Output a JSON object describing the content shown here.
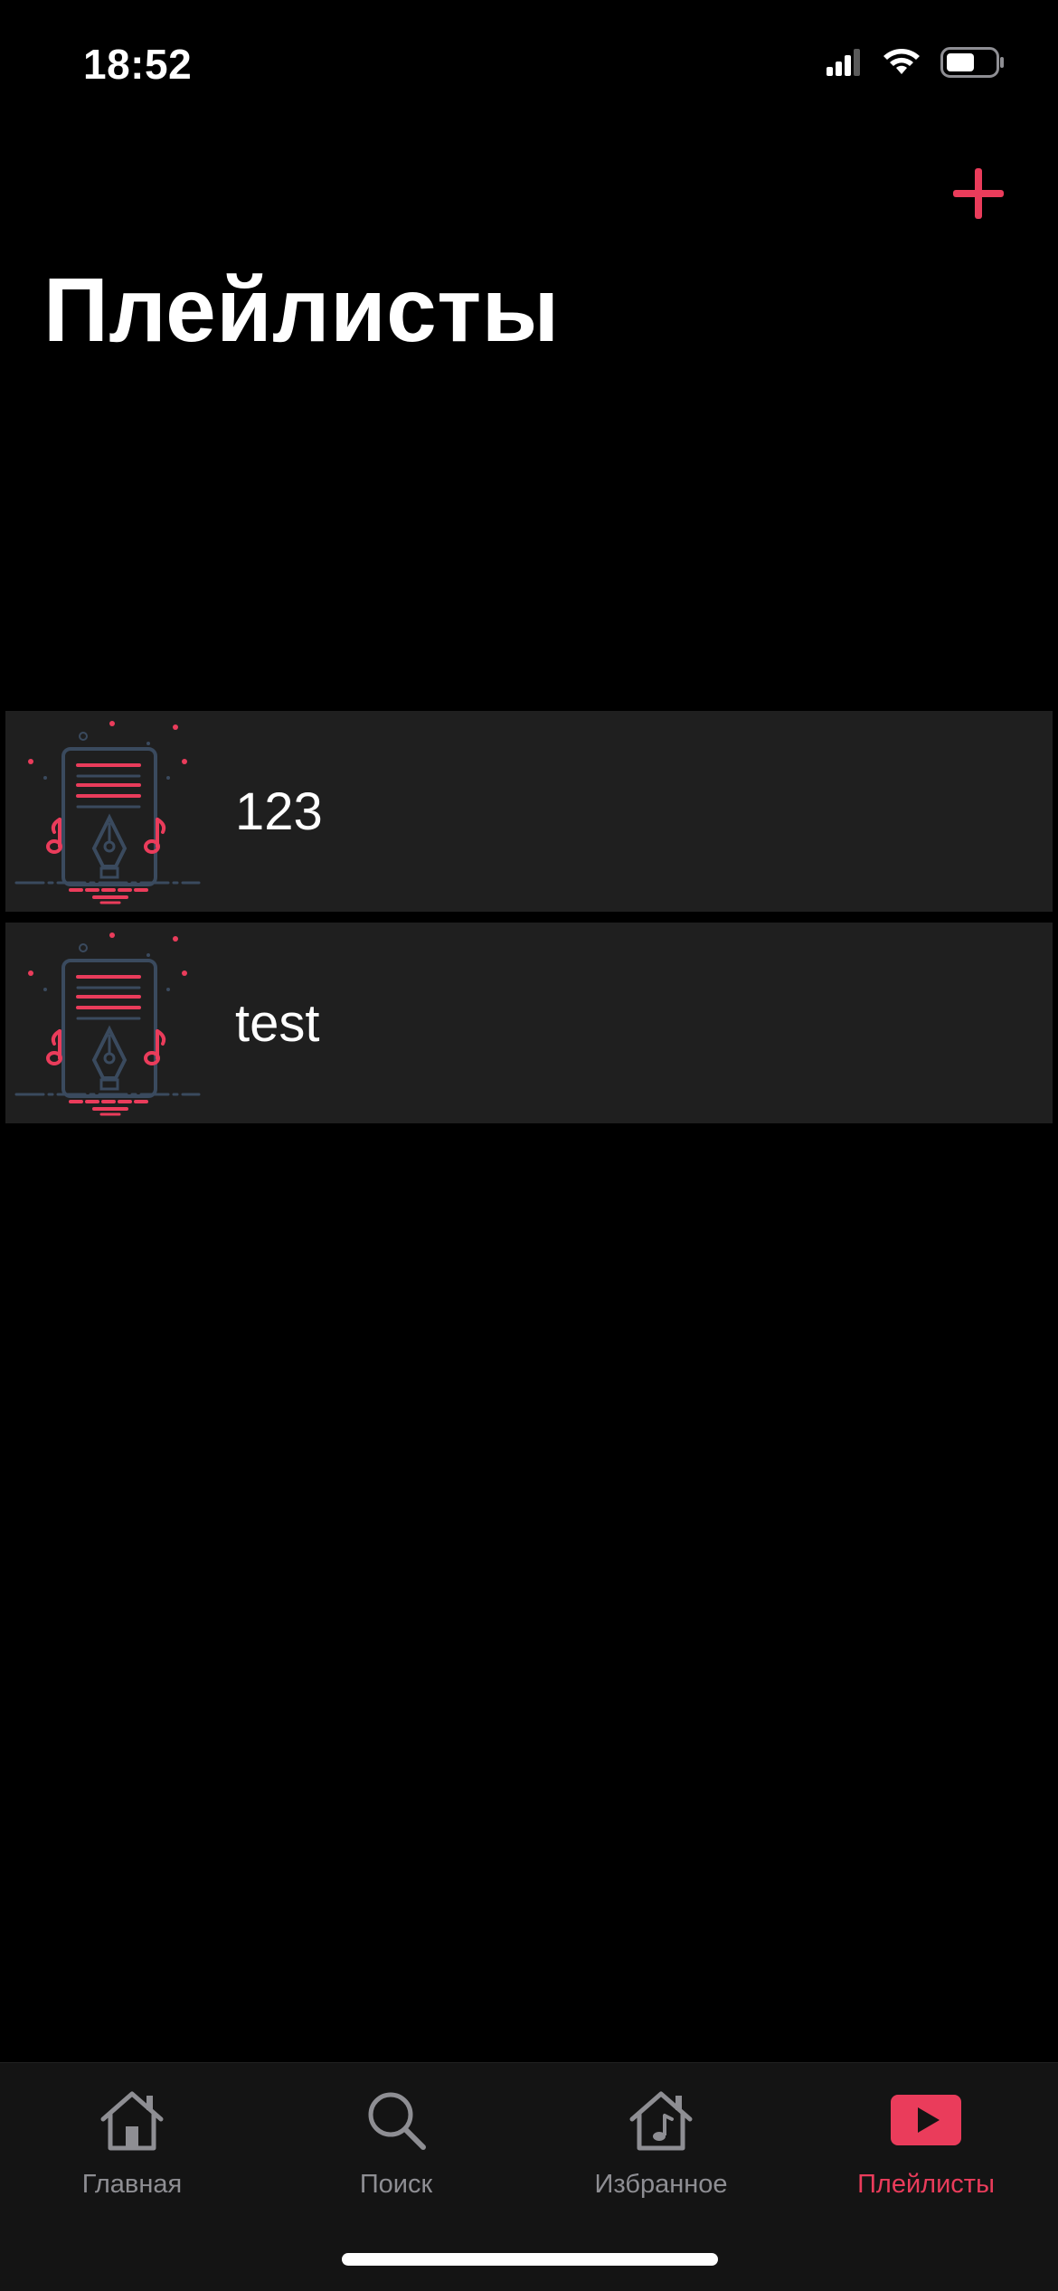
{
  "status_bar": {
    "time": "18:52",
    "icons": [
      "cellular-signal-icon",
      "wifi-icon",
      "battery-icon"
    ]
  },
  "header": {
    "title": "Плейлисты",
    "add_icon": "plus-icon"
  },
  "playlists": [
    {
      "name": "123",
      "thumbnail_icon": "music-sheet-pen-icon"
    },
    {
      "name": "test",
      "thumbnail_icon": "music-sheet-pen-icon"
    }
  ],
  "tab_bar": {
    "tabs": [
      {
        "label": "Главная",
        "icon": "home-icon",
        "active": false
      },
      {
        "label": "Поиск",
        "icon": "search-icon",
        "active": false
      },
      {
        "label": "Избранное",
        "icon": "music-house-icon",
        "active": false
      },
      {
        "label": "Плейлисты",
        "icon": "play-icon",
        "active": true
      }
    ]
  },
  "colors": {
    "accent": "#ea3c5b",
    "background": "#000000",
    "row_background": "#1f1f1f",
    "tab_bar_background": "#141414",
    "inactive_tab": "#8e8e93",
    "illustration_line": "#3a4a5e"
  }
}
